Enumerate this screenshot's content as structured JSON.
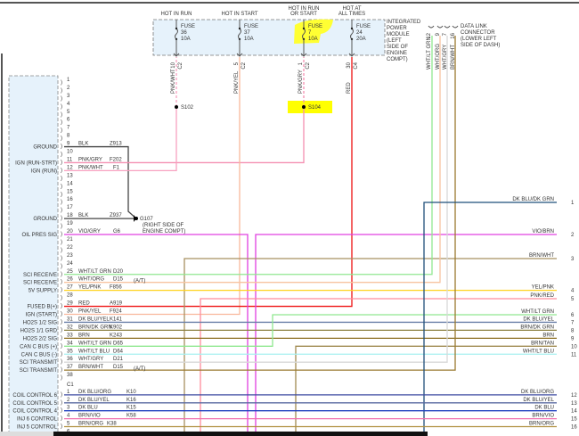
{
  "ipm": {
    "title": [
      "INTEGRATED",
      "POWER",
      "MODULE",
      "(LEFT",
      "SIDE OF",
      "ENGINE",
      "COMPT)"
    ],
    "fuses": [
      {
        "header": [
          "HOT IN RUN"
        ],
        "label": "FUSE",
        "number": "36",
        "amps": "10A",
        "pin": "10",
        "conn": "C2",
        "wire": "PNK/WHT",
        "color": "#f7a1c0",
        "dashed": true
      },
      {
        "header": [
          "HOT IN START"
        ],
        "label": "FUSE",
        "number": "37",
        "amps": "10A",
        "pin": "5",
        "conn": "C2",
        "wire": "PNK/YEL",
        "color": "#f9b89c",
        "dashed": false
      },
      {
        "header": [
          "HOT IN RUN",
          "OR START"
        ],
        "label": "FUSE",
        "number": "7",
        "amps": "10A",
        "pin": "1",
        "conn": "C2",
        "wire": "PNK/GRY",
        "color": "#f48fb1",
        "dashed": true,
        "highlighted": true
      },
      {
        "header": [
          "HOT AT",
          "ALL TIMES"
        ],
        "label": "FUSE",
        "number": "24",
        "amps": "20A",
        "pin": "30",
        "conn": "C4",
        "wire": "RED",
        "color": "#ee1111",
        "dashed": false
      }
    ]
  },
  "splices": {
    "s102": "S102",
    "s104": "S104",
    "highlight_color": "#ffff00"
  },
  "ground": {
    "name": "G107",
    "note": [
      "(RIGHT SIDE OF",
      "ENGINE COMPT)"
    ]
  },
  "dlc": {
    "title": [
      "DATA LINK",
      "CONNECTOR",
      "(LOWER LEFT",
      "SIDE OF DASH)"
    ],
    "pins": [
      {
        "pin": "12",
        "wire": "WHT/LT GRN",
        "color": "#90e890"
      },
      {
        "pin": "9",
        "wire": "WHT/ORG",
        "color": "#f8c4a0"
      },
      {
        "pin": "7",
        "wire": "WHT/GRY",
        "color": "#d8d8d8"
      },
      {
        "pin": "16",
        "wire": "BRN/WHT",
        "color": "#9a7a30"
      }
    ]
  },
  "c2": [
    {
      "pin": "1"
    },
    {
      "pin": "2"
    },
    {
      "pin": "3"
    },
    {
      "pin": "4"
    },
    {
      "pin": "5"
    },
    {
      "pin": "6"
    },
    {
      "pin": "7"
    },
    {
      "pin": "8"
    },
    {
      "pin": "9",
      "func": "GROUND",
      "wire": "BLK",
      "circuit": "Z913",
      "color": "#444444"
    },
    {
      "pin": "10"
    },
    {
      "pin": "11",
      "func": "IGN (RUN-STRT)",
      "wire": "PNK/GRY",
      "circuit": "F202",
      "color": "#f48fb1"
    },
    {
      "pin": "12",
      "func": "IGN (RUN)",
      "wire": "PNK/WHT",
      "circuit": "F1",
      "color": "#f7a1c0"
    },
    {
      "pin": "13"
    },
    {
      "pin": "14"
    },
    {
      "pin": "15"
    },
    {
      "pin": "16"
    },
    {
      "pin": "17"
    },
    {
      "pin": "18",
      "func": "GROUND",
      "wire": "BLK",
      "circuit": "Z937",
      "color": "#444444"
    },
    {
      "pin": "19"
    },
    {
      "pin": "20",
      "func": "OIL PRES SIG",
      "wire": "VIO/GRY",
      "circuit": "G6",
      "color": "#e040e0"
    },
    {
      "pin": "21"
    },
    {
      "pin": "22"
    },
    {
      "pin": "23"
    },
    {
      "pin": "24"
    },
    {
      "pin": "25",
      "func": "SCI RECEIVE",
      "wire": "WHT/LT GRN",
      "circuit": "D20",
      "color": "#90e890"
    },
    {
      "pin": "26",
      "func": "SCI RECEIVE",
      "wire": "WHT/ORG",
      "circuit": "D15",
      "note": "(A/T)",
      "color": "#f8c4a0"
    },
    {
      "pin": "27",
      "func": "5V SUPPLY",
      "wire": "YEL/PNK",
      "circuit": "F856",
      "color": "#ffd21f"
    },
    {
      "pin": "28"
    },
    {
      "pin": "29",
      "func": "FUSED B(+)",
      "wire": "RED",
      "circuit": "A919",
      "color": "#ee1111"
    },
    {
      "pin": "30",
      "func": "IGN (START)",
      "wire": "PNK/YEL",
      "circuit": "F924",
      "color": "#f9b89c"
    },
    {
      "pin": "31",
      "func": "HO2S 1/2 SIG",
      "wire": "DK BLU/YEL",
      "circuit": "K141",
      "color": "#6a7fa8"
    },
    {
      "pin": "32",
      "func": "HO2S 1/1 GRD",
      "wire": "BRN/DK GRN",
      "circuit": "K902",
      "color": "#8a8040"
    },
    {
      "pin": "33",
      "func": "HO2S 2/2 SIG",
      "wire": "BRN",
      "circuit": "K243",
      "color": "#8b6d1f"
    },
    {
      "pin": "34",
      "func": "CAN C BUS (+)",
      "wire": "WHT/LT GRN",
      "circuit": "D65",
      "color": "#90e890"
    },
    {
      "pin": "35",
      "func": "CAN C BUS (-)",
      "wire": "WHT/LT BLU",
      "circuit": "D64",
      "color": "#a8f0f0"
    },
    {
      "pin": "36",
      "func": "SCI TRANSMIT",
      "wire": "WHT/GRY",
      "circuit": "D21",
      "color": "#d8d8d8"
    },
    {
      "pin": "37",
      "func": "SCI TRANSMIT",
      "wire": "BRN/WHT",
      "circuit": "D15",
      "note": "(A/T)",
      "color": "#9a7a30"
    },
    {
      "pin": "38"
    }
  ],
  "c1_label": "C1",
  "c1": [
    {
      "pin": "1",
      "func": "COIL CONTROL 6",
      "wire": "DK BLU/ORG",
      "circuit": "K10",
      "color": "#3c4aa0"
    },
    {
      "pin": "2",
      "func": "COIL CONTROL 5",
      "wire": "DK BLU/YEL",
      "circuit": "K16",
      "color": "#5a6aa0"
    },
    {
      "pin": "3",
      "func": "COIL CONTROL 4",
      "wire": "DK BLU",
      "circuit": "K15",
      "color": "#2040c0"
    },
    {
      "pin": "4",
      "func": "INJ 6 CONTROL",
      "wire": "BRN/VIO",
      "circuit": "K58",
      "color": "#f070b0"
    },
    {
      "pin": "5",
      "func": "INJ 5 CONTROL",
      "wire": "BRN/ORG",
      "circuit": "K38",
      "color": "#b09040"
    },
    {
      "pin": "6"
    }
  ],
  "right": [
    {
      "num": "1",
      "wire": "DK BLU/DK GRN",
      "color": "#1f4f7a"
    },
    {
      "num": "2",
      "wire": "VIO/BRN",
      "color": "#e040e0"
    },
    {
      "num": "3",
      "wire": "BRN/WHT",
      "color": "#a89060"
    },
    {
      "num": "4",
      "wire": "YEL/PNK",
      "color": "#ffd21f"
    },
    {
      "num": "5",
      "wire": "PNK/RED",
      "color": "#ff8c9a"
    },
    {
      "num": "6",
      "wire": "WHT/LT GRN",
      "color": "#90e890"
    },
    {
      "num": "7",
      "wire": "DK BLU/YEL",
      "color": "#6a7fa8"
    },
    {
      "num": "8",
      "wire": "BRN/DK GRN",
      "color": "#8a8040"
    },
    {
      "num": "9",
      "wire": "BRN",
      "color": "#8b6d1f"
    },
    {
      "num": "10",
      "wire": "BRN/TAN",
      "color": "#a08a50"
    },
    {
      "num": "11",
      "wire": "WHT/LT BLU",
      "color": "#a8f0f0"
    },
    {
      "num": "12",
      "wire": "DK BLU/ORG",
      "color": "#3c4aa0"
    },
    {
      "num": "13",
      "wire": "DK BLU/YEL",
      "color": "#5a6aa0"
    },
    {
      "num": "14",
      "wire": "DK BLU",
      "color": "#2040c0"
    },
    {
      "num": "15",
      "wire": "BRN/VIO",
      "color": "#f070b0"
    },
    {
      "num": "16",
      "wire": "BRN/ORG",
      "color": "#b09040"
    }
  ]
}
